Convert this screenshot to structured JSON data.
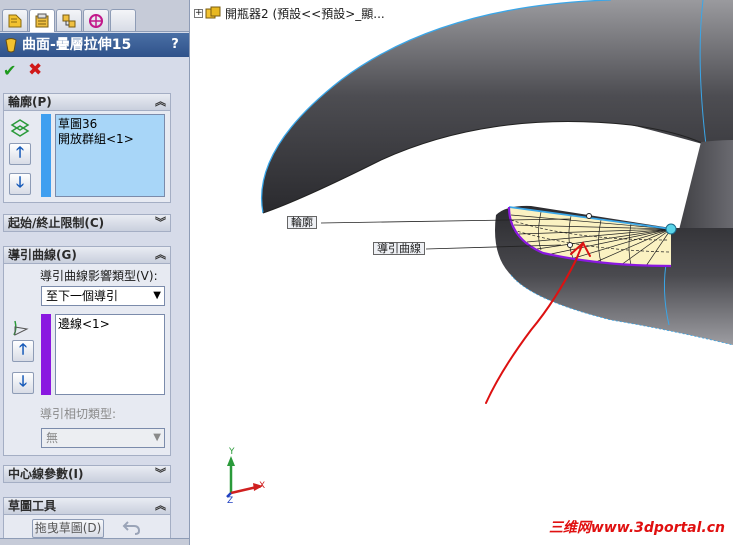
{
  "tabs": [
    {
      "icon": "feature-manager-icon",
      "active": false
    },
    {
      "icon": "property-manager-icon",
      "active": true
    },
    {
      "icon": "configuration-manager-icon",
      "active": false
    },
    {
      "icon": "dimxpert-icon",
      "active": false
    },
    {
      "icon": "blank-tab",
      "active": false
    }
  ],
  "property_manager": {
    "title": "曲面-疊層拉伸15",
    "help_label": "?",
    "ok_label": "✔",
    "cancel_label": "✖"
  },
  "profile_group": {
    "header": "輪廓(P)",
    "items": [
      "草圖36",
      "開放群組<1>"
    ],
    "colors": {
      "bar": "#3f9ff0",
      "list_bg": "#a8d6f8"
    }
  },
  "start_end_group": {
    "header": "起始/終止限制(C)"
  },
  "guide_group": {
    "header": "導引曲線(G)",
    "influence_label": "導引曲線影響類型(V):",
    "influence_value": "至下一個導引",
    "items": [
      "邊線<1>"
    ],
    "tangency_label": "導引相切類型:",
    "tangency_value": "無",
    "colors": {
      "bar": "#8a18e0"
    }
  },
  "centerline_group": {
    "header": "中心線參數(I)"
  },
  "sketch_tools_group": {
    "header": "草圖工具",
    "drag_sketch_label": "拖曳草圖(D)",
    "undo_icon": "undo-icon"
  },
  "viewport": {
    "tree_label": "開瓶器2 (預設<<預設>_顯...",
    "callout_profile": "輪廓",
    "callout_guide": "導引曲線",
    "triad": {
      "x": "X",
      "y": "Y",
      "z": "Z"
    },
    "watermark": "三维网www.3dportal.cn",
    "colors": {
      "annotation_arrow": "#dd1111",
      "profile_edge": "#3aa6e8",
      "guide_edge": "#8a18e0"
    }
  }
}
